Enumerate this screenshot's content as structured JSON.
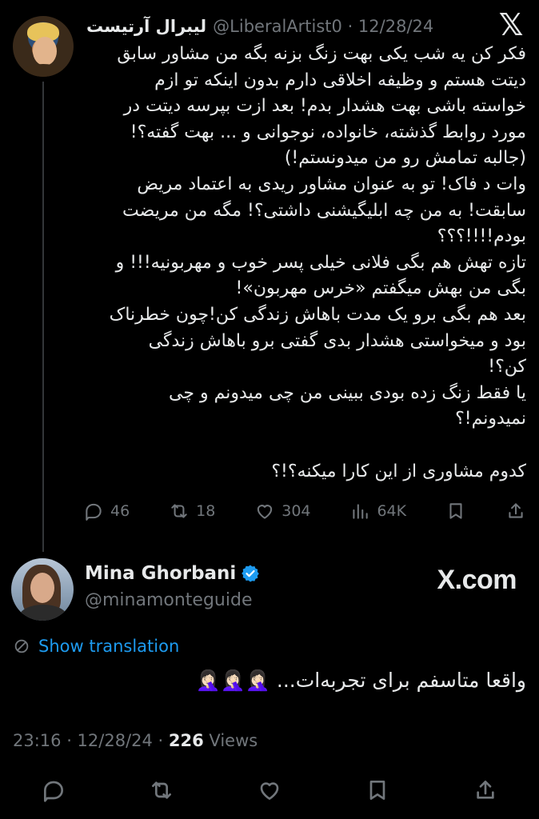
{
  "parent": {
    "name": "لیبرال آرتیست",
    "handle": "@LiberalArtist0 · 12/28/24",
    "lines": [
      "فکر کن یه شب یکی بهت زنگ بزنه بگه من مشاور سابق",
      "دیتت هستم و وظیفه اخلاقی دارم بدون اینکه تو ازم",
      "خواسته باشی بهت هشدار بدم! بعد ازت بپرسه دیتت در",
      "مورد روابط گذشته، خانواده، نوجوانی و ... بهت گفته؟!",
      "(جالبه تمامش رو من میدونستم!)",
      "وات د فاک! تو به عنوان مشاور ریدی به اعتماد مریض",
      "سابقت! به من چه ابلیگیشنی داشتی؟! مگه من مریضت",
      "بودم!!!!؟؟؟",
      "تازه تهش هم بگی فلانی خیلی پسر خوب و مهربونیه!!! و",
      "بگی من بهش میگفتم «خرس مهربون»!",
      "بعد هم بگی برو یک مدت باهاش زندگی کن!چون خطرناک",
      "بود و میخواستی هشدار بدی گفتی برو باهاش زندگی",
      "کن؟!",
      "یا فقط زنگ زده بودی ببینی من چی میدونم و چی",
      "نمیدونم!؟",
      "",
      "کدوم مشاوری از این کارا میکنه؟!؟"
    ],
    "actions": {
      "replies": "46",
      "reposts": "18",
      "likes": "304",
      "views": "64K"
    }
  },
  "reply": {
    "name": "Mina Ghorbani",
    "handle": "@minamonteguide",
    "brand": "X.com",
    "show_translation": "Show translation",
    "text": "واقعا متاسفم برای تجربه‌ات... 🤦🏻‍♀️🤦🏻‍♀️🤦🏻‍♀️",
    "time_date": "23:16 · 12/28/24 · ",
    "views_count": "226",
    "views_label": " Views"
  },
  "colors": {
    "background": "#000000",
    "text": "#e7e9ea",
    "muted": "#71767b",
    "accent": "#1d9bf0"
  }
}
